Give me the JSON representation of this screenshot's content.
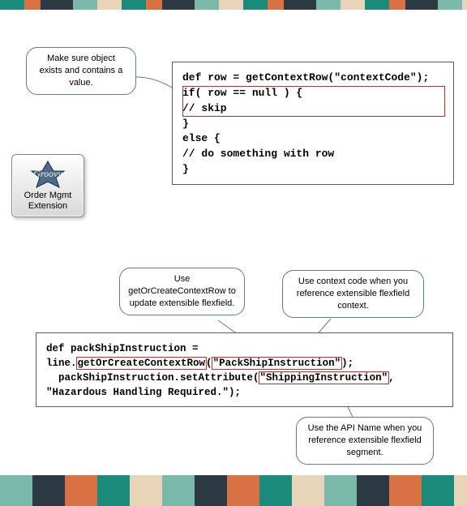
{
  "callouts": {
    "topLeft": "Make sure object exists and contains a value.",
    "left": "Use getOrCreateContextRow to update extensible flexfield.",
    "right": "Use context code when you reference  extensible flexfield context.",
    "bottom": "Use the API Name when you reference  extensible flexfield segment."
  },
  "badge": {
    "script": "Groovy",
    "label": "Order Mgmt Extension"
  },
  "code1": {
    "l1": "def row = getContextRow(\"contextCode\");",
    "l2": "if( row == null ) {",
    "l3": "// skip",
    "l4": "}",
    "l5": "else {",
    "l6": "// do something with row",
    "l7": "}"
  },
  "code2": {
    "pre1": "def packShipInstruction =",
    "pre2a": "line.",
    "hl1": "getOrCreateContextRow",
    "pre2b": "(",
    "hl2": "\"PackShipInstruction\"",
    "pre2c": ");",
    "pre3a": "  packShipInstruction.setAttribute(",
    "hl3": "\"ShippingInstruction\"",
    "pre3b": ",",
    "pre4": "\"Hazardous Handling Required.\");"
  }
}
